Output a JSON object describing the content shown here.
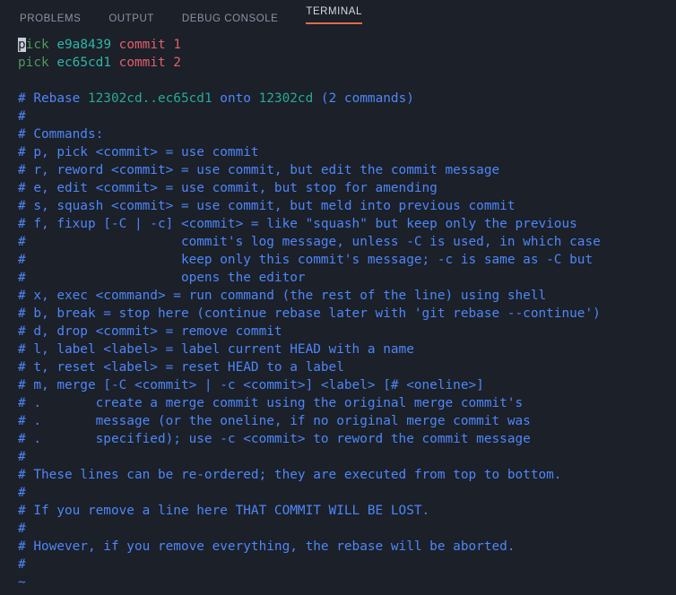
{
  "panel": {
    "tabs": [
      {
        "label": "PROBLEMS",
        "active": false
      },
      {
        "label": "OUTPUT",
        "active": false
      },
      {
        "label": "DEBUG CONSOLE",
        "active": false
      },
      {
        "label": "TERMINAL",
        "active": true
      }
    ],
    "active_tab": "TERMINAL",
    "active_underline_color": "#e06c4f"
  },
  "colors": {
    "background": "#1b2029",
    "comment_blue": "#4f86f7",
    "command_green": "#4e9a58",
    "hash_cyan": "#2eb6a8",
    "message_red": "#e0606a",
    "cursor_bg": "#c8cdd6",
    "tab_inactive": "#8a93a3",
    "tab_active": "#d4dae4"
  },
  "terminal": {
    "editor": "git-rebase-todo",
    "cursor": {
      "line": 1,
      "column": 1,
      "char": "p"
    },
    "lines": [
      {
        "id": "l1",
        "segs": [
          {
            "t": "p",
            "c": "cursor"
          },
          {
            "t": "ick",
            "c": "green"
          },
          {
            "t": " ",
            "c": "plain"
          },
          {
            "t": "e9a8439",
            "c": "cyan"
          },
          {
            "t": " ",
            "c": "plain"
          },
          {
            "t": "commit 1",
            "c": "red"
          }
        ]
      },
      {
        "id": "l2",
        "segs": [
          {
            "t": "pick",
            "c": "green"
          },
          {
            "t": " ",
            "c": "plain"
          },
          {
            "t": "ec65cd1",
            "c": "cyan"
          },
          {
            "t": " ",
            "c": "plain"
          },
          {
            "t": "commit 2",
            "c": "red"
          }
        ]
      },
      {
        "id": "l3",
        "segs": []
      },
      {
        "id": "l4",
        "segs": [
          {
            "t": "# Rebase ",
            "c": "blue"
          },
          {
            "t": "12302cd",
            "c": "teal"
          },
          {
            "t": "..",
            "c": "teal"
          },
          {
            "t": "ec65cd1",
            "c": "teal"
          },
          {
            "t": " onto ",
            "c": "blue"
          },
          {
            "t": "12302cd",
            "c": "teal"
          },
          {
            "t": " (2 commands)",
            "c": "blue"
          }
        ]
      },
      {
        "id": "l5",
        "segs": [
          {
            "t": "#",
            "c": "blue"
          }
        ]
      },
      {
        "id": "l6",
        "segs": [
          {
            "t": "# Commands:",
            "c": "blue"
          }
        ]
      },
      {
        "id": "l7",
        "segs": [
          {
            "t": "# p, pick <commit> = use commit",
            "c": "blue"
          }
        ]
      },
      {
        "id": "l8",
        "segs": [
          {
            "t": "# r, reword <commit> = use commit, but edit the commit message",
            "c": "blue"
          }
        ]
      },
      {
        "id": "l9",
        "segs": [
          {
            "t": "# e, edit <commit> = use commit, but stop for amending",
            "c": "blue"
          }
        ]
      },
      {
        "id": "l10",
        "segs": [
          {
            "t": "# s, squash <commit> = use commit, but meld into previous commit",
            "c": "blue"
          }
        ]
      },
      {
        "id": "l11",
        "segs": [
          {
            "t": "# f, fixup [-C | -c] <commit> = like \"squash\" but keep only the previous",
            "c": "blue"
          }
        ]
      },
      {
        "id": "l12",
        "segs": [
          {
            "t": "#                    commit's log message, unless -C is used, in which case",
            "c": "blue"
          }
        ]
      },
      {
        "id": "l13",
        "segs": [
          {
            "t": "#                    keep only this commit's message; -c is same as -C but",
            "c": "blue"
          }
        ]
      },
      {
        "id": "l14",
        "segs": [
          {
            "t": "#                    opens the editor",
            "c": "blue"
          }
        ]
      },
      {
        "id": "l15",
        "segs": [
          {
            "t": "# x, exec <command> = run command (the rest of the line) using shell",
            "c": "blue"
          }
        ]
      },
      {
        "id": "l16",
        "segs": [
          {
            "t": "# b, break = stop here (continue rebase later with 'git rebase --continue')",
            "c": "blue"
          }
        ]
      },
      {
        "id": "l17",
        "segs": [
          {
            "t": "# d, drop <commit> = remove commit",
            "c": "blue"
          }
        ]
      },
      {
        "id": "l18",
        "segs": [
          {
            "t": "# l, label <label> = label current HEAD with a name",
            "c": "blue"
          }
        ]
      },
      {
        "id": "l19",
        "segs": [
          {
            "t": "# t, reset <label> = reset HEAD to a label",
            "c": "blue"
          }
        ]
      },
      {
        "id": "l20",
        "segs": [
          {
            "t": "# m, merge [-C <commit> | -c <commit>] <label> [# <oneline>]",
            "c": "blue"
          }
        ]
      },
      {
        "id": "l21",
        "segs": [
          {
            "t": "# .       create a merge commit using the original merge commit's",
            "c": "blue"
          }
        ]
      },
      {
        "id": "l22",
        "segs": [
          {
            "t": "# .       message (or the oneline, if no original merge commit was",
            "c": "blue"
          }
        ]
      },
      {
        "id": "l23",
        "segs": [
          {
            "t": "# .       specified); use -c <commit> to reword the commit message",
            "c": "blue"
          }
        ]
      },
      {
        "id": "l24",
        "segs": [
          {
            "t": "#",
            "c": "blue"
          }
        ]
      },
      {
        "id": "l25",
        "segs": [
          {
            "t": "# These lines can be re-ordered; they are executed from top to bottom.",
            "c": "blue"
          }
        ]
      },
      {
        "id": "l26",
        "segs": [
          {
            "t": "#",
            "c": "blue"
          }
        ]
      },
      {
        "id": "l27",
        "segs": [
          {
            "t": "# If you remove a line here THAT COMMIT WILL BE LOST.",
            "c": "blue"
          }
        ]
      },
      {
        "id": "l28",
        "segs": [
          {
            "t": "#",
            "c": "blue"
          }
        ]
      },
      {
        "id": "l29",
        "segs": [
          {
            "t": "# However, if you remove everything, the rebase will be aborted.",
            "c": "blue"
          }
        ]
      },
      {
        "id": "l30",
        "segs": [
          {
            "t": "#",
            "c": "blue"
          }
        ]
      },
      {
        "id": "l31",
        "segs": [
          {
            "t": "~",
            "c": "blue"
          }
        ]
      }
    ]
  }
}
